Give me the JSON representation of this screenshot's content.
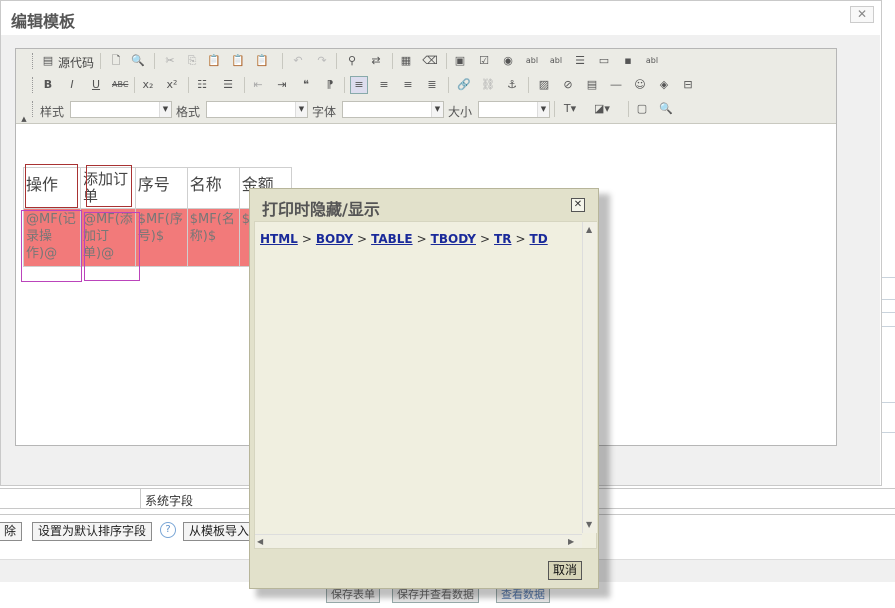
{
  "dialog": {
    "title": "编辑模板",
    "close_glyph": "✕"
  },
  "toolbar": {
    "source_label": "源代码",
    "style_label": "样式",
    "format_label": "格式",
    "font_label": "字体",
    "size_label": "大小",
    "style_value": "",
    "format_value": "",
    "font_value": "",
    "size_value": ""
  },
  "template_table": {
    "headers": [
      "操作",
      "添加订单",
      "序号",
      "名称",
      "金额"
    ],
    "cells": [
      "@MF(记录操作)@",
      "@MF(添加订单)@",
      "$MF(序号)$",
      "$MF(名称)$",
      "$"
    ]
  },
  "popup": {
    "title": "打印时隐藏/显示",
    "close_glyph": "✕",
    "breadcrumb": [
      "HTML",
      "BODY",
      "TABLE",
      "TBODY",
      "TR",
      "TD"
    ],
    "breadcrumb_separator": ">",
    "cancel_label": "取消"
  },
  "background": {
    "system_field_label": "系统字段",
    "delete_label": "除",
    "set_default_sort_label": "设置为默认排序字段",
    "help_glyph": "?",
    "import_from_template_label": "从模板导入",
    "bottom_buttons": [
      "保存表单",
      "保存并查看数据",
      "查看数据"
    ]
  },
  "colors": {
    "accent_red_cell": "#f27a7a",
    "popup_bg": "#e2e1cb",
    "link_blue": "#1a2a9a"
  }
}
